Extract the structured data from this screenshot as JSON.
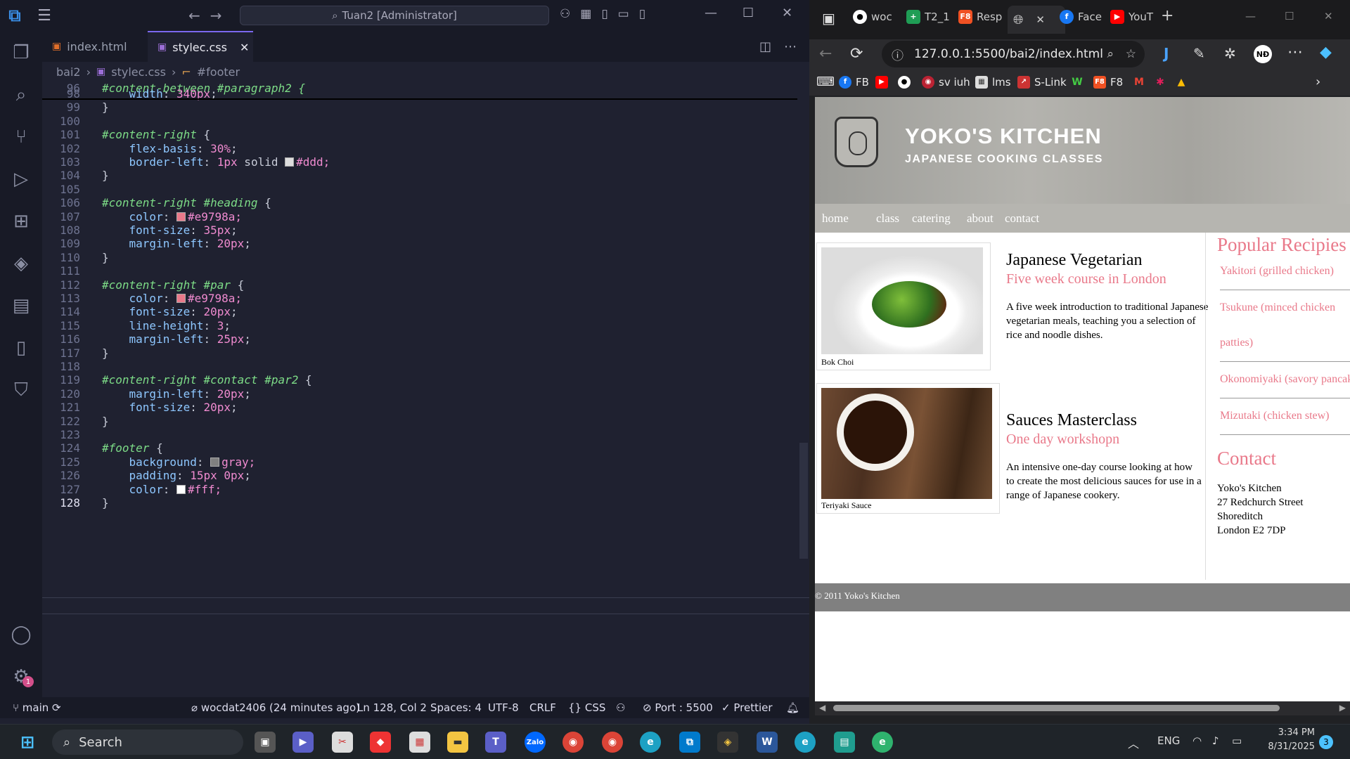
{
  "vscode": {
    "title_search": "Tuan2 [Administrator]",
    "tabs": [
      {
        "label": "index.html"
      },
      {
        "label": "stylec.css"
      }
    ],
    "breadcrumb": {
      "folder": "bai2",
      "file": "stylec.css",
      "symbol": "#footer"
    },
    "sticky": {
      "line": "96",
      "text": "#content-between #paragraph2 {"
    },
    "lines": [
      {
        "n": "98",
        "parts": [
          [
            "t",
            "    "
          ],
          [
            "p",
            "width"
          ],
          [
            "t",
            ": "
          ],
          [
            "v",
            "340px"
          ],
          [
            "t",
            ";"
          ]
        ]
      },
      {
        "n": "99",
        "parts": [
          [
            "t",
            "}"
          ]
        ]
      },
      {
        "n": "100",
        "parts": []
      },
      {
        "n": "101",
        "parts": [
          [
            "s",
            "#content-right"
          ],
          [
            "t",
            " {"
          ]
        ]
      },
      {
        "n": "102",
        "parts": [
          [
            "t",
            "    "
          ],
          [
            "p",
            "flex-basis"
          ],
          [
            "t",
            ": "
          ],
          [
            "v",
            "30%"
          ],
          [
            "t",
            ";"
          ]
        ]
      },
      {
        "n": "103",
        "parts": [
          [
            "t",
            "    "
          ],
          [
            "p",
            "border-left"
          ],
          [
            "t",
            ": "
          ],
          [
            "v",
            "1px"
          ],
          [
            "t",
            " solid "
          ],
          [
            "c",
            "#ddd"
          ],
          [
            "t",
            "#ddd;"
          ]
        ]
      },
      {
        "n": "104",
        "parts": [
          [
            "t",
            "}"
          ]
        ]
      },
      {
        "n": "105",
        "parts": []
      },
      {
        "n": "106",
        "parts": [
          [
            "s",
            "#content-right #heading"
          ],
          [
            "t",
            " {"
          ]
        ]
      },
      {
        "n": "107",
        "parts": [
          [
            "t",
            "    "
          ],
          [
            "p",
            "color"
          ],
          [
            "t",
            ": "
          ],
          [
            "c",
            "#e9798a"
          ],
          [
            "t",
            "#e9798a;"
          ]
        ]
      },
      {
        "n": "108",
        "parts": [
          [
            "t",
            "    "
          ],
          [
            "p",
            "font-size"
          ],
          [
            "t",
            ": "
          ],
          [
            "v",
            "35px"
          ],
          [
            "t",
            ";"
          ]
        ]
      },
      {
        "n": "109",
        "parts": [
          [
            "t",
            "    "
          ],
          [
            "p",
            "margin-left"
          ],
          [
            "t",
            ": "
          ],
          [
            "v",
            "20px"
          ],
          [
            "t",
            ";"
          ]
        ]
      },
      {
        "n": "110",
        "parts": [
          [
            "t",
            "}"
          ]
        ]
      },
      {
        "n": "111",
        "parts": []
      },
      {
        "n": "112",
        "parts": [
          [
            "s",
            "#content-right #par"
          ],
          [
            "t",
            " {"
          ]
        ]
      },
      {
        "n": "113",
        "parts": [
          [
            "t",
            "    "
          ],
          [
            "p",
            "color"
          ],
          [
            "t",
            ": "
          ],
          [
            "c",
            "#e9798a"
          ],
          [
            "t",
            "#e9798a;"
          ]
        ]
      },
      {
        "n": "114",
        "parts": [
          [
            "t",
            "    "
          ],
          [
            "p",
            "font-size"
          ],
          [
            "t",
            ": "
          ],
          [
            "v",
            "20px"
          ],
          [
            "t",
            ";"
          ]
        ]
      },
      {
        "n": "115",
        "parts": [
          [
            "t",
            "    "
          ],
          [
            "p",
            "line-height"
          ],
          [
            "t",
            ": "
          ],
          [
            "v",
            "3"
          ],
          [
            "t",
            ";"
          ]
        ]
      },
      {
        "n": "116",
        "parts": [
          [
            "t",
            "    "
          ],
          [
            "p",
            "margin-left"
          ],
          [
            "t",
            ": "
          ],
          [
            "v",
            "25px"
          ],
          [
            "t",
            ";"
          ]
        ]
      },
      {
        "n": "117",
        "parts": [
          [
            "t",
            "}"
          ]
        ]
      },
      {
        "n": "118",
        "parts": []
      },
      {
        "n": "119",
        "parts": [
          [
            "s",
            "#content-right #contact #par2"
          ],
          [
            "t",
            " {"
          ]
        ]
      },
      {
        "n": "120",
        "parts": [
          [
            "t",
            "    "
          ],
          [
            "p",
            "margin-left"
          ],
          [
            "t",
            ": "
          ],
          [
            "v",
            "20px"
          ],
          [
            "t",
            ";"
          ]
        ]
      },
      {
        "n": "121",
        "parts": [
          [
            "t",
            "    "
          ],
          [
            "p",
            "font-size"
          ],
          [
            "t",
            ": "
          ],
          [
            "v",
            "20px"
          ],
          [
            "t",
            ";"
          ]
        ]
      },
      {
        "n": "122",
        "parts": [
          [
            "t",
            "}"
          ]
        ]
      },
      {
        "n": "123",
        "parts": []
      },
      {
        "n": "124",
        "parts": [
          [
            "s",
            "#footer"
          ],
          [
            "t",
            " {"
          ]
        ]
      },
      {
        "n": "125",
        "parts": [
          [
            "t",
            "    "
          ],
          [
            "p",
            "background"
          ],
          [
            "t",
            ": "
          ],
          [
            "c",
            "gray"
          ],
          [
            "t",
            "gray;"
          ]
        ]
      },
      {
        "n": "126",
        "parts": [
          [
            "t",
            "    "
          ],
          [
            "p",
            "padding"
          ],
          [
            "t",
            ": "
          ],
          [
            "v",
            "15px 0px"
          ],
          [
            "t",
            ";"
          ]
        ]
      },
      {
        "n": "127",
        "parts": [
          [
            "t",
            "    "
          ],
          [
            "p",
            "color"
          ],
          [
            "t",
            ": "
          ],
          [
            "c",
            "#fff"
          ],
          [
            "t",
            "#fff;"
          ]
        ]
      },
      {
        "n": "128",
        "parts": [
          [
            "t",
            "}"
          ]
        ]
      }
    ],
    "status": {
      "branch": "main",
      "commit": "wocdat2406 (24 minutes ago)",
      "cursor": "Ln 128, Col 2",
      "spaces": "Spaces: 4",
      "encoding": "UTF-8",
      "eol": "CRLF",
      "lang": "CSS",
      "port": "Port : 5500",
      "formatter": "Prettier"
    },
    "settings_badge": "1"
  },
  "browser": {
    "tabs": [
      {
        "label": "woc",
        "icon": "github-icon"
      },
      {
        "label": "T2_1",
        "icon": "sheets-icon"
      },
      {
        "label": "Resp",
        "icon": "f8-icon"
      },
      {
        "label": "",
        "icon": "globe-icon"
      },
      {
        "label": "Face",
        "icon": "facebook-icon"
      },
      {
        "label": "YouT",
        "icon": "youtube-icon"
      }
    ],
    "url": "127.0.0.1:5500/bai2/index.html",
    "profile": "NĐ",
    "bookmarks": [
      {
        "label": "FB"
      },
      {
        "label": ""
      },
      {
        "label": ""
      },
      {
        "label": "sv iuh"
      },
      {
        "label": "lms"
      },
      {
        "label": "S-Link"
      },
      {
        "label": ""
      },
      {
        "label": "F8"
      }
    ]
  },
  "site": {
    "title": "YOKO'S KITCHEN",
    "subtitle": "JAPANESE COOKING CLASSES",
    "nav": [
      "home",
      "class",
      "catering",
      "about",
      "contact"
    ],
    "courses": [
      {
        "caption": "Bok Choi",
        "heading": "Japanese Vegetarian",
        "sub": "Five week course in London",
        "desc": "A five week introduction to traditional Japanese vegetarian meals, teaching you a selection of rice and noodle dishes."
      },
      {
        "caption": "Teriyaki Sauce",
        "heading": "Sauces Masterclass",
        "sub": "One day workshopn",
        "desc": "An intensive one-day course looking at how to create the most delicious sauces for use in a range of Japanese cookery."
      }
    ],
    "popular_heading": "Popular Recipies",
    "recipes": [
      "Yakitori (grilled chicken)",
      "Tsukune (minced chicken",
      "patties)",
      "Okonomiyaki (savory pancakes)",
      "Mizutaki (chicken stew)"
    ],
    "contact_heading": "Contact",
    "address": [
      "Yoko's Kitchen",
      "27 Redchurch Street",
      "Shoreditch",
      "London E2 7DP"
    ],
    "footer": "© 2011 Yoko's Kitchen"
  },
  "taskbar": {
    "search": "Search",
    "lang": "ENG",
    "time": "3:34 PM",
    "date": "8/31/2025",
    "notif": "3"
  }
}
